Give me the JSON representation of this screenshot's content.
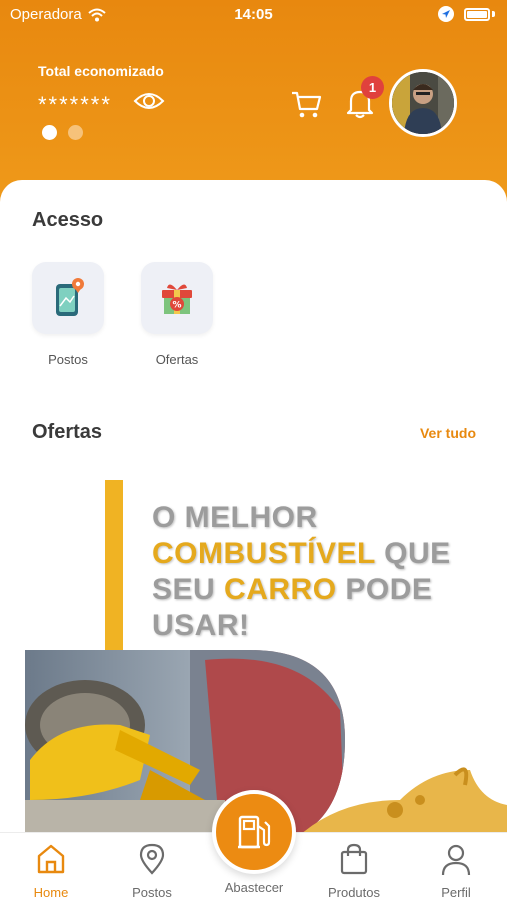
{
  "status_bar": {
    "carrier": "Operadora",
    "time": "14:05"
  },
  "header": {
    "saved_label": "Total economizado",
    "saved_value": "*******",
    "notification_count": "1",
    "carousel_pages": 2,
    "carousel_active": 1
  },
  "access": {
    "title": "Acesso",
    "items": [
      {
        "label": "Postos",
        "icon": "map-pin-phone-icon"
      },
      {
        "label": "Ofertas",
        "icon": "gift-percent-icon"
      }
    ]
  },
  "offers": {
    "title": "Ofertas",
    "see_all": "Ver tudo",
    "banner": {
      "line1": "O MELHOR",
      "line2_highlight": "COMBUSTÍVEL",
      "line2_rest": " QUE",
      "line3_start": "SEU ",
      "line3_highlight": "CARRO",
      "line3_rest": " PODE",
      "line4": "USAR!"
    }
  },
  "bottom_nav": {
    "items": [
      {
        "label": "Home",
        "icon": "home-icon",
        "active": true
      },
      {
        "label": "Postos",
        "icon": "map-pin-icon",
        "active": false
      },
      {
        "label": "Abastecer",
        "icon": "fuel-pump-icon",
        "active": false
      },
      {
        "label": "Produtos",
        "icon": "shopping-bag-icon",
        "active": false
      },
      {
        "label": "Perfil",
        "icon": "user-icon",
        "active": false
      }
    ]
  },
  "colors": {
    "accent": "#e8890f",
    "header": "#ec8f14",
    "highlight": "#e5a91d",
    "badge": "#e0413d"
  }
}
